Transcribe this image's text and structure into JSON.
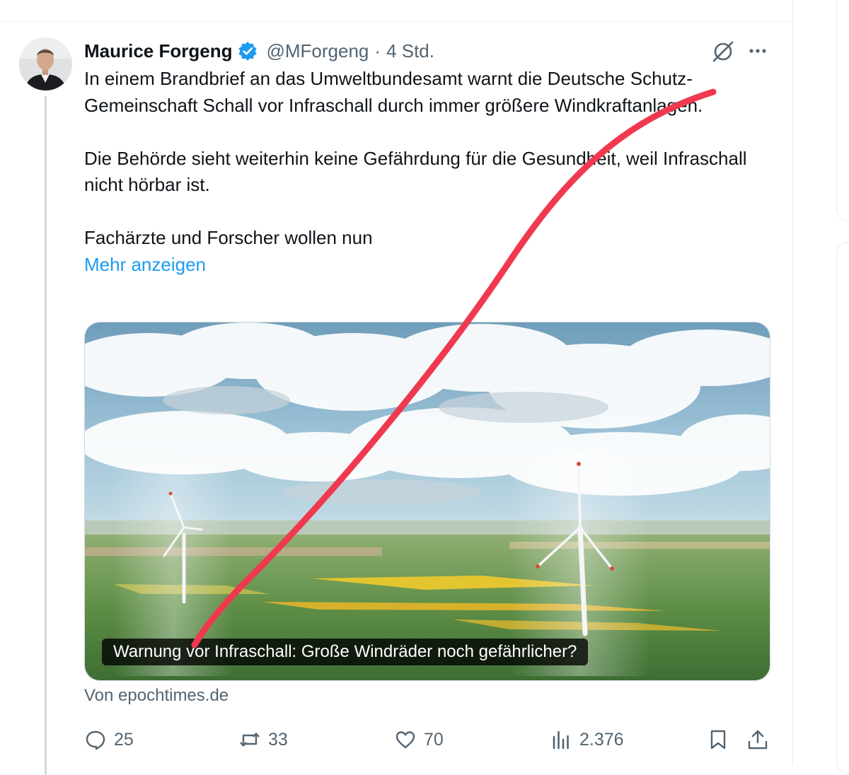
{
  "post": {
    "author": {
      "name": "Maurice Forgeng",
      "handle": "@MForgeng",
      "separator": "·",
      "time": "4 Std.",
      "verified_icon": "verified-badge-icon"
    },
    "text": {
      "paragraph1": "In einem Brandbrief an das Umweltbundesamt warnt die Deutsche Schutz-Gemeinschaft Schall vor  Infraschall durch immer größere Windkraftanlagen.",
      "paragraph2": "Die Behörde sieht weiterhin keine Gefährdung für die Gesundheit, weil Infraschall nicht hörbar ist.",
      "paragraph3": "Fachärzte und Forscher wollen nun",
      "show_more": "Mehr anzeigen"
    },
    "card": {
      "caption": "Warnung vor Infraschall: Große Windräder noch gefährlicher?",
      "source": "Von epochtimes.de",
      "image_icon": "wind-turbines-image"
    },
    "actions": {
      "replies": "25",
      "reposts": "33",
      "likes": "70",
      "views": "2.376",
      "icons": [
        "reply-icon",
        "repost-icon",
        "like-icon",
        "views-icon",
        "bookmark-icon",
        "share-icon"
      ]
    }
  },
  "colors": {
    "accent": "#1d9bf0",
    "text": "#0f1419",
    "secondary": "#536471",
    "annotation_stroke": "#f0394f"
  }
}
